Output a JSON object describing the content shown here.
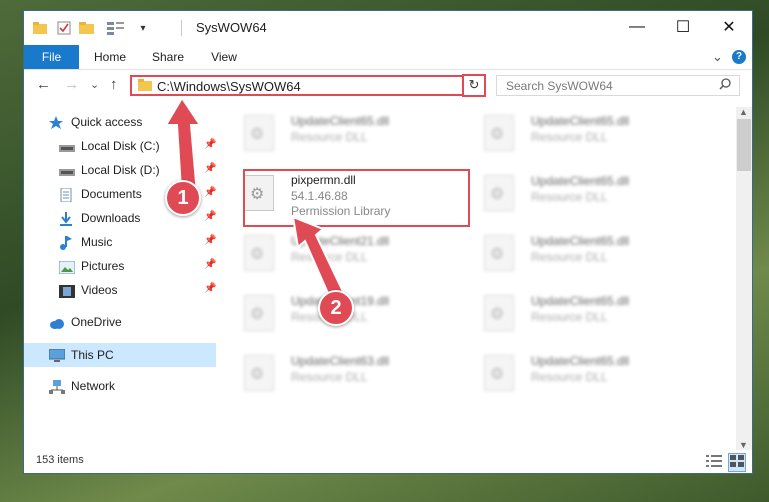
{
  "window": {
    "title": "SysWOW64"
  },
  "window_controls": {
    "minimize": "—",
    "maximize": "☐",
    "close": "✕"
  },
  "ribbon": {
    "tabs": [
      "File",
      "Home",
      "Share",
      "View"
    ],
    "expand": "⌄",
    "help": "?"
  },
  "nav": {
    "back": "←",
    "forward": "→",
    "recent": "⌄",
    "up": "↑"
  },
  "address": {
    "path": "C:\\Windows\\SysWOW64",
    "dropdown": "⌄",
    "refresh": "↻"
  },
  "search": {
    "placeholder": "Search SysWOW64",
    "icon": "search-icon"
  },
  "sidebar": {
    "items": [
      {
        "label": "Quick access",
        "icon": "star-icon",
        "pinned": false
      },
      {
        "label": "Local Disk (C:)",
        "icon": "drive-icon",
        "pinned": true
      },
      {
        "label": "Local Disk (D:)",
        "icon": "drive-icon",
        "pinned": true
      },
      {
        "label": "Documents",
        "icon": "documents-icon",
        "pinned": true
      },
      {
        "label": "Downloads",
        "icon": "downloads-icon",
        "pinned": true
      },
      {
        "label": "Music",
        "icon": "music-icon",
        "pinned": true
      },
      {
        "label": "Pictures",
        "icon": "pictures-icon",
        "pinned": true
      },
      {
        "label": "Videos",
        "icon": "videos-icon",
        "pinned": true
      },
      {
        "label": "OneDrive",
        "icon": "cloud-icon",
        "pinned": false
      },
      {
        "label": "This PC",
        "icon": "computer-icon",
        "pinned": false,
        "selected": true
      },
      {
        "label": "Network",
        "icon": "network-icon",
        "pinned": false
      }
    ]
  },
  "files": [
    {
      "name": "UpdateClient65.dll",
      "desc": "Resource DLL",
      "blurred": true
    },
    {
      "name": "UpdateClient65.dll",
      "desc": "Resource DLL",
      "blurred": true
    },
    {
      "name": "pixpermn.dll",
      "version": "54.1.46.88",
      "desc": "Permission Library",
      "blurred": false
    },
    {
      "name": "UpdateClient65.dll",
      "desc": "Resource DLL",
      "blurred": true
    },
    {
      "name": "UpdateClient21.dll",
      "desc": "Resource DLL",
      "blurred": true
    },
    {
      "name": "UpdateClient65.dll",
      "desc": "Resource DLL",
      "blurred": true
    },
    {
      "name": "UpdateClient19.dll",
      "desc": "Resource DLL",
      "blurred": true
    },
    {
      "name": "UpdateClient65.dll",
      "desc": "Resource DLL",
      "blurred": true
    },
    {
      "name": "UpdateClient63.dll",
      "desc": "Resource DLL",
      "blurred": true
    },
    {
      "name": "UpdateClient65.dll",
      "desc": "Resource DLL",
      "blurred": true
    }
  ],
  "status": {
    "count": "153 items"
  },
  "callouts": [
    "1",
    "2"
  ],
  "colors": {
    "accent": "#1979ca",
    "highlight": "#e04a55",
    "selected": "#cce8ff"
  }
}
